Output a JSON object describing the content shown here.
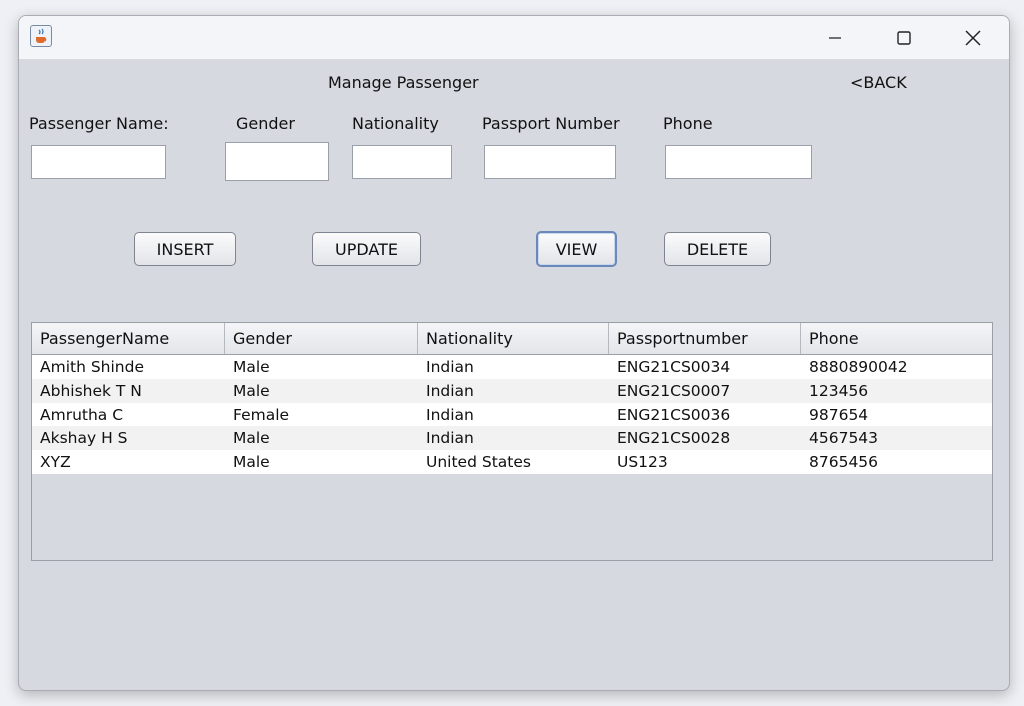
{
  "window": {
    "app_icon": "java-cup-icon",
    "controls": {
      "minimize": "—",
      "maximize": "☐",
      "close": "✕"
    }
  },
  "header": {
    "title": "Manage Passenger",
    "back_label": "<BACK"
  },
  "form": {
    "labels": {
      "name": "Passenger Name:",
      "gender": "Gender",
      "nationality": "Nationality",
      "passport": "Passport Number",
      "phone": "Phone"
    },
    "values": {
      "name": "",
      "gender": "",
      "nationality": "",
      "passport": "",
      "phone": ""
    }
  },
  "buttons": {
    "insert": "INSERT",
    "update": "UPDATE",
    "view": "VIEW",
    "delete": "DELETE"
  },
  "table": {
    "columns": [
      "PassengerName",
      "Gender",
      "Nationality",
      "Passportnumber",
      "Phone"
    ],
    "rows": [
      [
        "Amith Shinde",
        "Male",
        "Indian",
        "ENG21CS0034",
        "8880890042"
      ],
      [
        "Abhishek T N",
        "Male",
        "Indian",
        "ENG21CS0007",
        "123456"
      ],
      [
        "Amrutha C",
        "Female",
        "Indian",
        "ENG21CS0036",
        "987654"
      ],
      [
        "Akshay H S",
        "Male",
        "Indian",
        "ENG21CS0028",
        "4567543"
      ],
      [
        "XYZ",
        "Male",
        "United States",
        "US123",
        "8765456"
      ]
    ]
  },
  "colors": {
    "window_bg": "#d6d9e0",
    "titlebar_bg": "#f4f5f8",
    "focus_border": "#6b89b8"
  }
}
